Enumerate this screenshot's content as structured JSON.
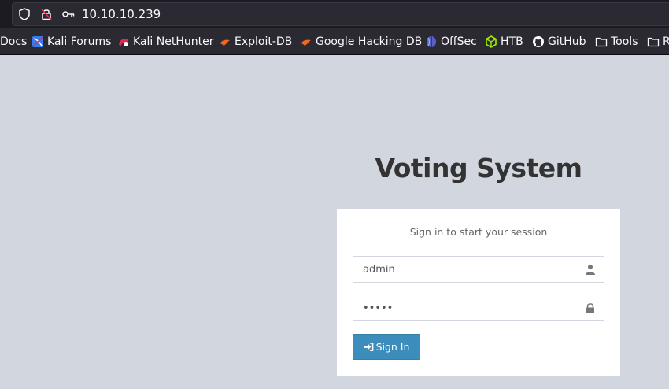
{
  "browser": {
    "url": "10.10.10.239",
    "bookmarks": [
      {
        "label": "Docs",
        "icon": "none"
      },
      {
        "label": "Kali Forums",
        "icon": "kali-forums-icon"
      },
      {
        "label": "Kali NetHunter",
        "icon": "kali-nethunter-icon"
      },
      {
        "label": "Exploit-DB",
        "icon": "exploit-db-icon"
      },
      {
        "label": "Google Hacking DB",
        "icon": "ghdb-icon"
      },
      {
        "label": "OffSec",
        "icon": "offsec-icon"
      },
      {
        "label": "HTB",
        "icon": "htb-icon"
      },
      {
        "label": "GitHub",
        "icon": "github-icon"
      },
      {
        "label": "Tools",
        "icon": "folder-icon"
      },
      {
        "label": "R",
        "icon": "folder-icon"
      }
    ]
  },
  "login": {
    "title": "Voting System",
    "message": "Sign in to start your session",
    "username_value": "admin",
    "password_value": "admin",
    "submit_label": "Sign In"
  },
  "colors": {
    "background": "#d2d6de",
    "button": "#3c8dbc",
    "toolbar": "#2b2a33"
  }
}
